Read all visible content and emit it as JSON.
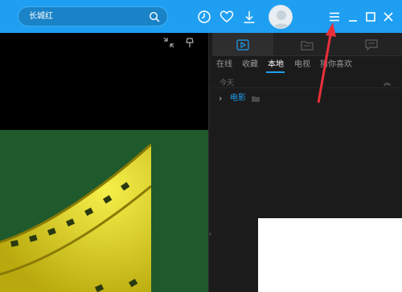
{
  "search": {
    "query": "长城红"
  },
  "titlebar": {
    "icons": [
      "history-icon",
      "heart-icon",
      "download-icon",
      "avatar",
      "menu-icon",
      "minimize-icon",
      "maximize-icon",
      "close-icon"
    ]
  },
  "player": {
    "icons": [
      "fullscreen-exit-icon",
      "pin-icon"
    ]
  },
  "panel": {
    "tabs": [
      "play-list-icon",
      "folder-icon",
      "message-icon"
    ],
    "active_tab": 0,
    "subtabs": [
      "在线",
      "收藏",
      "本地",
      "电视",
      "猜你喜欢"
    ],
    "active_subtab": "本地",
    "date_group": "今天",
    "folder": {
      "label": "电影"
    }
  },
  "colors": {
    "brand": "#1e9ff2",
    "panel_bg": "#1b1b1b",
    "annotation": "#e8303a"
  }
}
